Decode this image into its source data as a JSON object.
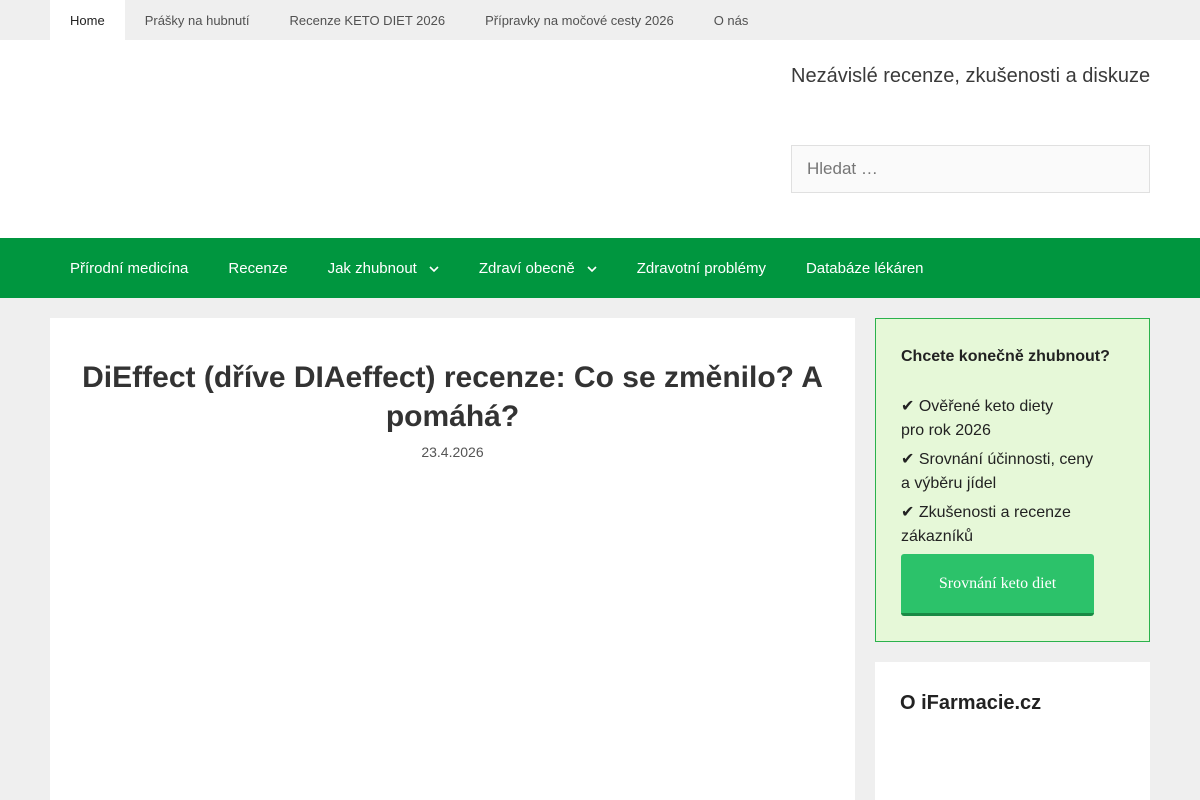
{
  "top_nav": {
    "items": [
      {
        "label": "Home"
      },
      {
        "label": "Prášky na hubnutí"
      },
      {
        "label": "Recenze KETO DIET 2026"
      },
      {
        "label": "Přípravky na močové cesty 2026"
      },
      {
        "label": "O nás"
      }
    ],
    "active_index": 0
  },
  "header": {
    "tagline": "Nezávislé recenze, zkušenosti a diskuze",
    "search_placeholder": "Hledat …"
  },
  "main_nav": {
    "items": [
      {
        "label": "Přírodní medicína"
      },
      {
        "label": "Recenze"
      },
      {
        "label": "Jak zhubnout",
        "icon": "chevron-down-icon"
      },
      {
        "label": "Zdraví obecně",
        "icon": "chevron-down-icon"
      },
      {
        "label": "Zdravotní problémy"
      },
      {
        "label": "Databáze lékáren"
      }
    ],
    "background_color": "#00963f"
  },
  "article": {
    "title": "DiEffect (dříve DIAeffect) recenze: Co se změnilo? A pomáhá?",
    "date": "23.4.2026"
  },
  "promo": {
    "heading": "Chcete konečně zhubnout?",
    "items": [
      "✔ Ověřené keto diety pro rok 2026",
      "✔ Srovnání účinnosti, ceny a výběru jídel",
      "✔ Zkušenosti a recenze zákazníků"
    ],
    "button_label": "Srovnání keto diet",
    "background_color": "#e6f8d8",
    "button_color": "#2cc26a"
  },
  "about_widget": {
    "title": "O iFarmacie.cz"
  }
}
